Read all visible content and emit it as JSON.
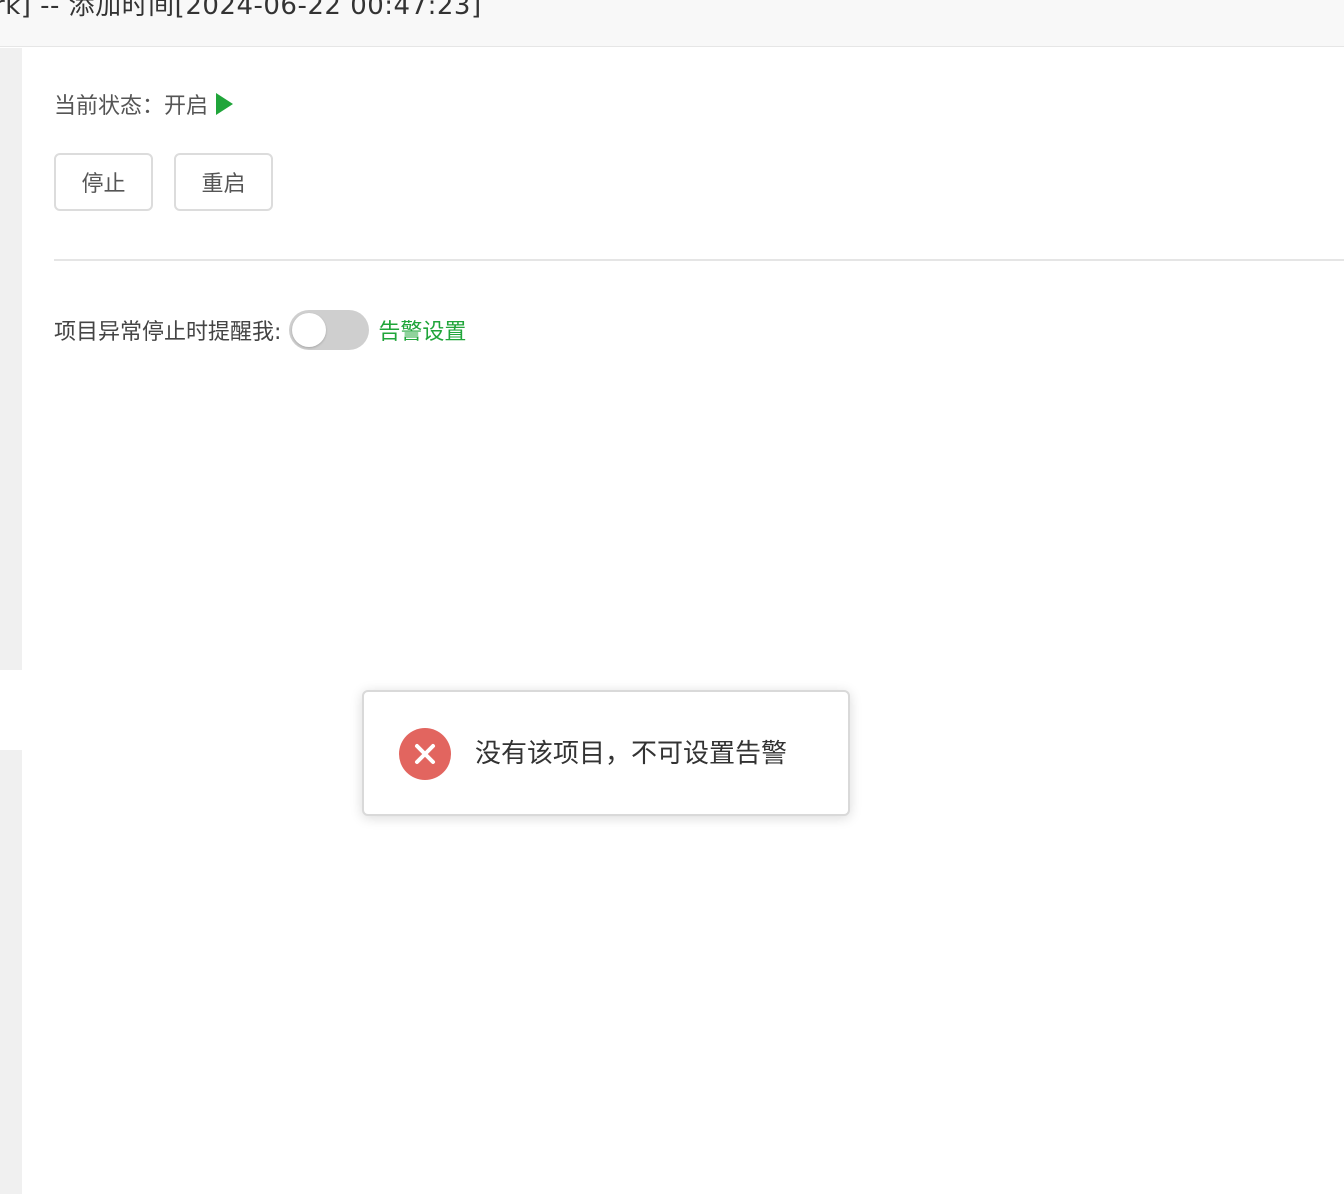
{
  "header": {
    "title": "rk] -- 添加时间[2024-06-22 00:47:23]"
  },
  "status": {
    "label": "当前状态：",
    "value": "开启",
    "icon": "play-icon",
    "icon_color": "#20a53a"
  },
  "actions": {
    "stop_label": "停止",
    "restart_label": "重启"
  },
  "alert": {
    "label": "项目异常停止时提醒我:",
    "toggle_on": false,
    "settings_link": "告警设置",
    "link_color": "#20a53a"
  },
  "toast": {
    "icon": "error-icon",
    "icon_color": "#e2655f",
    "message": "没有该项目，不可设置告警"
  }
}
